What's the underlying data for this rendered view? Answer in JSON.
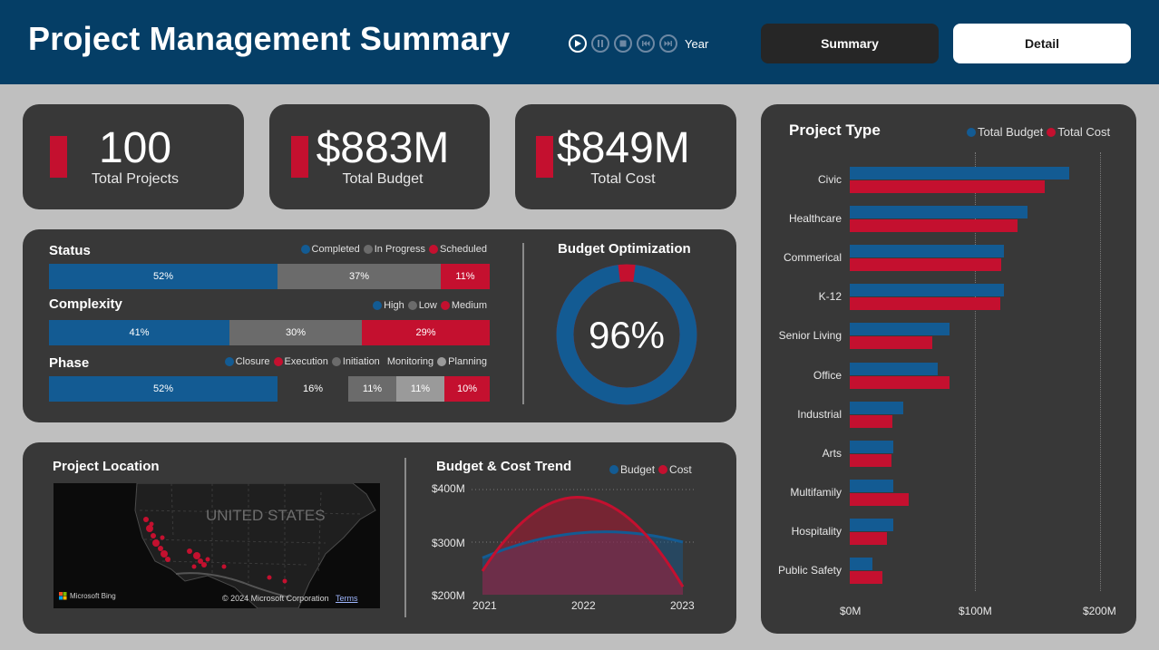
{
  "header": {
    "title": "Project Management Summary",
    "player_label": "Year",
    "nav": {
      "summary": "Summary",
      "detail": "Detail"
    }
  },
  "kpis": {
    "total_projects": {
      "value": "100",
      "label": "Total Projects"
    },
    "total_budget": {
      "value": "$883M",
      "label": "Total Budget"
    },
    "total_cost": {
      "value": "$849M",
      "label": "Total Cost"
    }
  },
  "status": {
    "title": "Status",
    "legend": [
      "Completed",
      "In Progress",
      "Scheduled"
    ],
    "segments": [
      "52%",
      "37%",
      "11%"
    ]
  },
  "complexity": {
    "title": "Complexity",
    "legend": [
      "High",
      "Low",
      "Medium"
    ],
    "segments": [
      "41%",
      "30%",
      "29%"
    ]
  },
  "phase": {
    "title": "Phase",
    "legend": [
      "Closure",
      "Execution",
      "Initiation",
      "Monitoring",
      "Planning"
    ],
    "segments": [
      "52%",
      "16%",
      "11%",
      "11%",
      "10%"
    ]
  },
  "budget_optimization": {
    "title": "Budget Optimization",
    "value": "96%",
    "fraction": 0.96
  },
  "project_location": {
    "title": "Project Location",
    "map_label": "UNITED STATES",
    "provider": "Microsoft Bing",
    "copyright": "© 2024 Microsoft Corporation",
    "terms": "Terms"
  },
  "colors": {
    "blue": "#135b93",
    "red": "#c4102f",
    "gray": "#6b6b6b",
    "dark": "#383838",
    "light_gray": "#9a9a9a"
  },
  "trend": {
    "title": "Budget & Cost Trend",
    "legend": [
      "Budget",
      "Cost"
    ],
    "ytick_labels": [
      "$400M",
      "$300M",
      "$200M"
    ],
    "xtick_labels": [
      "2021",
      "2022",
      "2023"
    ]
  },
  "project_type": {
    "title": "Project Type",
    "legend": [
      "Total Budget",
      "Total Cost"
    ],
    "xtick_labels": [
      "$0M",
      "$100M",
      "$200M"
    ]
  },
  "chart_data": [
    {
      "type": "line",
      "title": "Budget & Cost Trend",
      "x": [
        "2021",
        "2022",
        "2023"
      ],
      "ylim": [
        200,
        400
      ],
      "series": [
        {
          "name": "Budget",
          "values": [
            270,
            318,
            300
          ]
        },
        {
          "name": "Cost",
          "values": [
            245,
            385,
            215
          ]
        }
      ]
    },
    {
      "type": "bar",
      "title": "Project Type",
      "categories": [
        "Civic",
        "Healthcare",
        "Commerical",
        "K-12",
        "Senior Living",
        "Office",
        "Industrial",
        "Arts",
        "Multifamily",
        "Hospitality",
        "Public Safety"
      ],
      "xlim": [
        0,
        210
      ],
      "series": [
        {
          "name": "Total Budget",
          "values": [
            175,
            142,
            123,
            123,
            80,
            70,
            43,
            35,
            35,
            35,
            18
          ]
        },
        {
          "name": "Total Cost",
          "values": [
            156,
            134,
            121,
            120,
            66,
            80,
            34,
            33,
            47,
            30,
            26
          ]
        }
      ]
    }
  ]
}
